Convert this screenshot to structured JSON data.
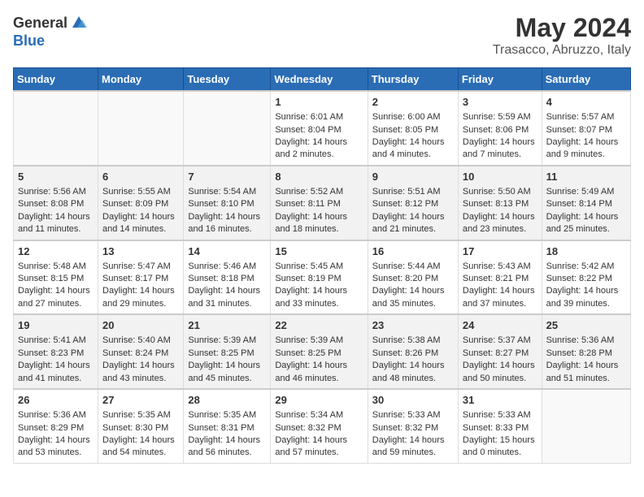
{
  "header": {
    "logo_general": "General",
    "logo_blue": "Blue",
    "title": "May 2024",
    "subtitle": "Trasacco, Abruzzo, Italy"
  },
  "weekdays": [
    "Sunday",
    "Monday",
    "Tuesday",
    "Wednesday",
    "Thursday",
    "Friday",
    "Saturday"
  ],
  "weeks": [
    [
      {
        "day": "",
        "sunrise": "",
        "sunset": "",
        "daylight": "",
        "empty": true
      },
      {
        "day": "",
        "sunrise": "",
        "sunset": "",
        "daylight": "",
        "empty": true
      },
      {
        "day": "",
        "sunrise": "",
        "sunset": "",
        "daylight": "",
        "empty": true
      },
      {
        "day": "1",
        "sunrise": "Sunrise: 6:01 AM",
        "sunset": "Sunset: 8:04 PM",
        "daylight": "Daylight: 14 hours and 2 minutes."
      },
      {
        "day": "2",
        "sunrise": "Sunrise: 6:00 AM",
        "sunset": "Sunset: 8:05 PM",
        "daylight": "Daylight: 14 hours and 4 minutes."
      },
      {
        "day": "3",
        "sunrise": "Sunrise: 5:59 AM",
        "sunset": "Sunset: 8:06 PM",
        "daylight": "Daylight: 14 hours and 7 minutes."
      },
      {
        "day": "4",
        "sunrise": "Sunrise: 5:57 AM",
        "sunset": "Sunset: 8:07 PM",
        "daylight": "Daylight: 14 hours and 9 minutes."
      }
    ],
    [
      {
        "day": "5",
        "sunrise": "Sunrise: 5:56 AM",
        "sunset": "Sunset: 8:08 PM",
        "daylight": "Daylight: 14 hours and 11 minutes."
      },
      {
        "day": "6",
        "sunrise": "Sunrise: 5:55 AM",
        "sunset": "Sunset: 8:09 PM",
        "daylight": "Daylight: 14 hours and 14 minutes."
      },
      {
        "day": "7",
        "sunrise": "Sunrise: 5:54 AM",
        "sunset": "Sunset: 8:10 PM",
        "daylight": "Daylight: 14 hours and 16 minutes."
      },
      {
        "day": "8",
        "sunrise": "Sunrise: 5:52 AM",
        "sunset": "Sunset: 8:11 PM",
        "daylight": "Daylight: 14 hours and 18 minutes."
      },
      {
        "day": "9",
        "sunrise": "Sunrise: 5:51 AM",
        "sunset": "Sunset: 8:12 PM",
        "daylight": "Daylight: 14 hours and 21 minutes."
      },
      {
        "day": "10",
        "sunrise": "Sunrise: 5:50 AM",
        "sunset": "Sunset: 8:13 PM",
        "daylight": "Daylight: 14 hours and 23 minutes."
      },
      {
        "day": "11",
        "sunrise": "Sunrise: 5:49 AM",
        "sunset": "Sunset: 8:14 PM",
        "daylight": "Daylight: 14 hours and 25 minutes."
      }
    ],
    [
      {
        "day": "12",
        "sunrise": "Sunrise: 5:48 AM",
        "sunset": "Sunset: 8:15 PM",
        "daylight": "Daylight: 14 hours and 27 minutes."
      },
      {
        "day": "13",
        "sunrise": "Sunrise: 5:47 AM",
        "sunset": "Sunset: 8:17 PM",
        "daylight": "Daylight: 14 hours and 29 minutes."
      },
      {
        "day": "14",
        "sunrise": "Sunrise: 5:46 AM",
        "sunset": "Sunset: 8:18 PM",
        "daylight": "Daylight: 14 hours and 31 minutes."
      },
      {
        "day": "15",
        "sunrise": "Sunrise: 5:45 AM",
        "sunset": "Sunset: 8:19 PM",
        "daylight": "Daylight: 14 hours and 33 minutes."
      },
      {
        "day": "16",
        "sunrise": "Sunrise: 5:44 AM",
        "sunset": "Sunset: 8:20 PM",
        "daylight": "Daylight: 14 hours and 35 minutes."
      },
      {
        "day": "17",
        "sunrise": "Sunrise: 5:43 AM",
        "sunset": "Sunset: 8:21 PM",
        "daylight": "Daylight: 14 hours and 37 minutes."
      },
      {
        "day": "18",
        "sunrise": "Sunrise: 5:42 AM",
        "sunset": "Sunset: 8:22 PM",
        "daylight": "Daylight: 14 hours and 39 minutes."
      }
    ],
    [
      {
        "day": "19",
        "sunrise": "Sunrise: 5:41 AM",
        "sunset": "Sunset: 8:23 PM",
        "daylight": "Daylight: 14 hours and 41 minutes."
      },
      {
        "day": "20",
        "sunrise": "Sunrise: 5:40 AM",
        "sunset": "Sunset: 8:24 PM",
        "daylight": "Daylight: 14 hours and 43 minutes."
      },
      {
        "day": "21",
        "sunrise": "Sunrise: 5:39 AM",
        "sunset": "Sunset: 8:25 PM",
        "daylight": "Daylight: 14 hours and 45 minutes."
      },
      {
        "day": "22",
        "sunrise": "Sunrise: 5:39 AM",
        "sunset": "Sunset: 8:25 PM",
        "daylight": "Daylight: 14 hours and 46 minutes."
      },
      {
        "day": "23",
        "sunrise": "Sunrise: 5:38 AM",
        "sunset": "Sunset: 8:26 PM",
        "daylight": "Daylight: 14 hours and 48 minutes."
      },
      {
        "day": "24",
        "sunrise": "Sunrise: 5:37 AM",
        "sunset": "Sunset: 8:27 PM",
        "daylight": "Daylight: 14 hours and 50 minutes."
      },
      {
        "day": "25",
        "sunrise": "Sunrise: 5:36 AM",
        "sunset": "Sunset: 8:28 PM",
        "daylight": "Daylight: 14 hours and 51 minutes."
      }
    ],
    [
      {
        "day": "26",
        "sunrise": "Sunrise: 5:36 AM",
        "sunset": "Sunset: 8:29 PM",
        "daylight": "Daylight: 14 hours and 53 minutes."
      },
      {
        "day": "27",
        "sunrise": "Sunrise: 5:35 AM",
        "sunset": "Sunset: 8:30 PM",
        "daylight": "Daylight: 14 hours and 54 minutes."
      },
      {
        "day": "28",
        "sunrise": "Sunrise: 5:35 AM",
        "sunset": "Sunset: 8:31 PM",
        "daylight": "Daylight: 14 hours and 56 minutes."
      },
      {
        "day": "29",
        "sunrise": "Sunrise: 5:34 AM",
        "sunset": "Sunset: 8:32 PM",
        "daylight": "Daylight: 14 hours and 57 minutes."
      },
      {
        "day": "30",
        "sunrise": "Sunrise: 5:33 AM",
        "sunset": "Sunset: 8:32 PM",
        "daylight": "Daylight: 14 hours and 59 minutes."
      },
      {
        "day": "31",
        "sunrise": "Sunrise: 5:33 AM",
        "sunset": "Sunset: 8:33 PM",
        "daylight": "Daylight: 15 hours and 0 minutes."
      },
      {
        "day": "",
        "sunrise": "",
        "sunset": "",
        "daylight": "",
        "empty": true
      }
    ]
  ]
}
